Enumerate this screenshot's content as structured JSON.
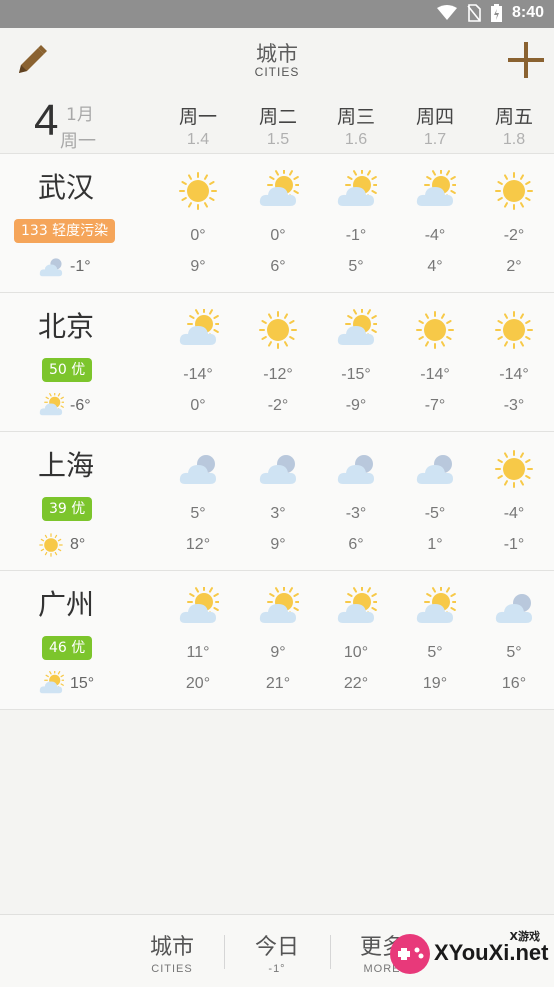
{
  "status_bar": {
    "time": "8:40",
    "icons": [
      "wifi-icon",
      "no-sim-icon",
      "battery-charging-icon"
    ]
  },
  "header": {
    "title_zh": "城市",
    "title_en": "CITIES",
    "left_icon": "pencil-icon",
    "right_icon": "plus-icon"
  },
  "date": {
    "day_number": "4",
    "month": "1月",
    "weekday": "周一"
  },
  "days": [
    {
      "name": "周一",
      "date": "1.4"
    },
    {
      "name": "周二",
      "date": "1.5"
    },
    {
      "name": "周三",
      "date": "1.6"
    },
    {
      "name": "周四",
      "date": "1.7"
    },
    {
      "name": "周五",
      "date": "1.8"
    }
  ],
  "cities": [
    {
      "name": "武汉",
      "aqi_label": "133 轻度污染",
      "aqi_color": "#f5a55a",
      "now_icon": "cloudy-icon",
      "now_temp": "-1°",
      "forecast": [
        {
          "icon": "sunny-icon",
          "low": "0°",
          "high": "9°"
        },
        {
          "icon": "partly-cloudy-icon",
          "low": "0°",
          "high": "6°"
        },
        {
          "icon": "partly-cloudy-icon",
          "low": "-1°",
          "high": "5°"
        },
        {
          "icon": "partly-cloudy-icon",
          "low": "-4°",
          "high": "4°"
        },
        {
          "icon": "sunny-icon",
          "low": "-2°",
          "high": "2°"
        }
      ]
    },
    {
      "name": "北京",
      "aqi_label": "50 优",
      "aqi_color": "#7cc52c",
      "now_icon": "partly-cloudy-icon",
      "now_temp": "-6°",
      "forecast": [
        {
          "icon": "partly-cloudy-icon",
          "low": "-14°",
          "high": "0°"
        },
        {
          "icon": "sunny-icon",
          "low": "-12°",
          "high": "-2°"
        },
        {
          "icon": "partly-cloudy-icon",
          "low": "-15°",
          "high": "-9°"
        },
        {
          "icon": "sunny-icon",
          "low": "-14°",
          "high": "-7°"
        },
        {
          "icon": "sunny-icon",
          "low": "-14°",
          "high": "-3°"
        }
      ]
    },
    {
      "name": "上海",
      "aqi_label": "39 优",
      "aqi_color": "#7cc52c",
      "now_icon": "sunny-icon",
      "now_temp": "8°",
      "forecast": [
        {
          "icon": "cloudy-icon",
          "low": "5°",
          "high": "12°"
        },
        {
          "icon": "cloudy-icon",
          "low": "3°",
          "high": "9°"
        },
        {
          "icon": "cloudy-icon",
          "low": "-3°",
          "high": "6°"
        },
        {
          "icon": "cloudy-icon",
          "low": "-5°",
          "high": "1°"
        },
        {
          "icon": "sunny-icon",
          "low": "-4°",
          "high": "-1°"
        }
      ]
    },
    {
      "name": "广州",
      "aqi_label": "46 优",
      "aqi_color": "#7cc52c",
      "now_icon": "partly-cloudy-icon",
      "now_temp": "15°",
      "forecast": [
        {
          "icon": "partly-cloudy-icon",
          "low": "11°",
          "high": "20°"
        },
        {
          "icon": "partly-cloudy-icon",
          "low": "9°",
          "high": "21°"
        },
        {
          "icon": "partly-cloudy-icon",
          "low": "10°",
          "high": "22°"
        },
        {
          "icon": "partly-cloudy-icon",
          "low": "5°",
          "high": "19°"
        },
        {
          "icon": "cloudy-icon",
          "low": "5°",
          "high": "16°"
        }
      ]
    }
  ],
  "bottom_nav": [
    {
      "zh": "城市",
      "en": "CITIES"
    },
    {
      "zh": "今日",
      "en": "-1°"
    },
    {
      "zh": "更多",
      "en": "MORE"
    }
  ],
  "watermark": {
    "text": "XYouXi.net",
    "small": "X游戏"
  },
  "colors": {
    "sun": "#f7c948",
    "cloud": "#cfe3f3",
    "cloud_gray": "#b9c8dc"
  }
}
